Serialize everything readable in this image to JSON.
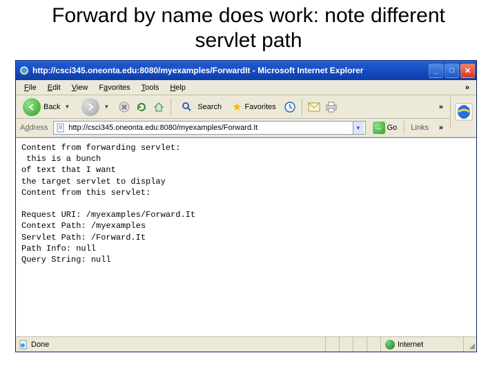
{
  "slide": {
    "title": "Forward by name does work: note different servlet path"
  },
  "window": {
    "title": "http://csci345.oneonta.edu:8080/myexamples/ForwardIt - Microsoft Internet Explorer"
  },
  "menubar": {
    "file": "File",
    "edit": "Edit",
    "view": "View",
    "favorites": "Favorites",
    "tools": "Tools",
    "help": "Help"
  },
  "toolbar": {
    "back": "Back",
    "search": "Search",
    "favorites": "Favorites"
  },
  "addressbar": {
    "label": "Address",
    "value": "http://csci345.oneonta.edu:8080/myexamples/Forward.It",
    "go": "Go",
    "links": "Links"
  },
  "page": {
    "lines": [
      "Content from forwarding servlet:",
      " this is a bunch",
      "of text that I want",
      "the target servlet to display",
      "Content from this servlet:",
      "",
      "Request URI: /myexamples/Forward.It",
      "Context Path: /myexamples",
      "Servlet Path: /Forward.It",
      "Path Info: null",
      "Query String: null"
    ]
  },
  "status": {
    "done": "Done",
    "zone": "Internet"
  }
}
